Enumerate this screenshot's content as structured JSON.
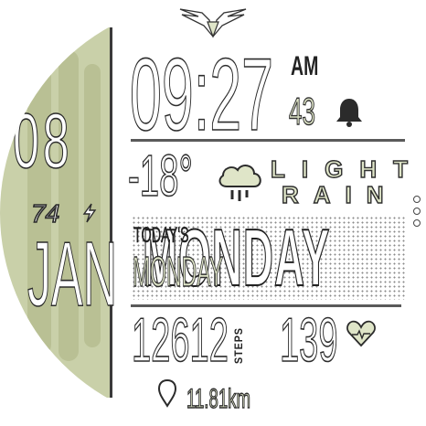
{
  "colors": {
    "accent": "#dfe5c8",
    "panel": "#c9d0a9",
    "ink": "#2b2b2b"
  },
  "logo": {
    "icon": "winged-emblem-icon"
  },
  "date": {
    "day": "08",
    "month": "JAN",
    "battery_value": "74",
    "battery_icon": "lightning-icon"
  },
  "time": {
    "hours": "09",
    "separator": ":",
    "minutes": "27",
    "ampm": "AM",
    "notifications": "43",
    "notification_icon": "bell-icon"
  },
  "weather": {
    "temperature": "-18",
    "unit": "°",
    "condition_line1": "LIGHT",
    "condition_line2": "RAIN",
    "icon": "cloud-rain-icon"
  },
  "day": {
    "label": "TODAY'S",
    "name": "MONDAY",
    "big_name": "MONDAY"
  },
  "steps": {
    "value": "12612",
    "label": "STEPS"
  },
  "heart": {
    "value": "139",
    "icon": "heart-icon"
  },
  "distance": {
    "value": "11.81km",
    "icon": "location-pin-icon"
  },
  "side_indicator": {
    "icon": "dots-indicator-icon"
  }
}
